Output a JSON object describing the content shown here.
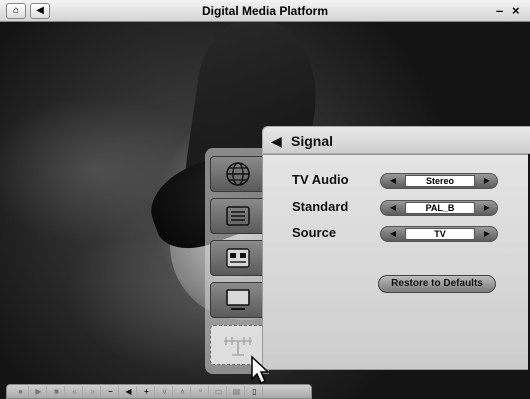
{
  "window": {
    "title": "Digital Media Platform",
    "home_icon": "home-icon",
    "back_icon": "back-arrow-icon",
    "minimize": "–",
    "close": "×"
  },
  "panel": {
    "title": "Signal",
    "rows": [
      {
        "label": "TV Audio",
        "value": "Stereo"
      },
      {
        "label": "Standard",
        "value": "PAL_B"
      },
      {
        "label": "Source",
        "value": "TV"
      }
    ],
    "restore_label": "Restore to Defaults"
  },
  "tabs": [
    "globe-icon",
    "list-icon",
    "tuner-icon",
    "monitor-icon",
    "antenna-icon"
  ],
  "transport": [
    {
      "glyph": "●",
      "on": false
    },
    {
      "glyph": "▶",
      "on": false
    },
    {
      "glyph": "■",
      "on": false
    },
    {
      "glyph": "«",
      "on": false
    },
    {
      "glyph": "»",
      "on": false
    },
    {
      "glyph": "–",
      "on": true
    },
    {
      "glyph": "◀",
      "on": true
    },
    {
      "glyph": "+",
      "on": true
    },
    {
      "glyph": "∨",
      "on": false
    },
    {
      "glyph": "∧",
      "on": false
    },
    {
      "glyph": "⁹",
      "on": false
    },
    {
      "glyph": "▭",
      "on": false
    },
    {
      "glyph": "▤",
      "on": false
    },
    {
      "glyph": "▯",
      "on": true
    }
  ]
}
